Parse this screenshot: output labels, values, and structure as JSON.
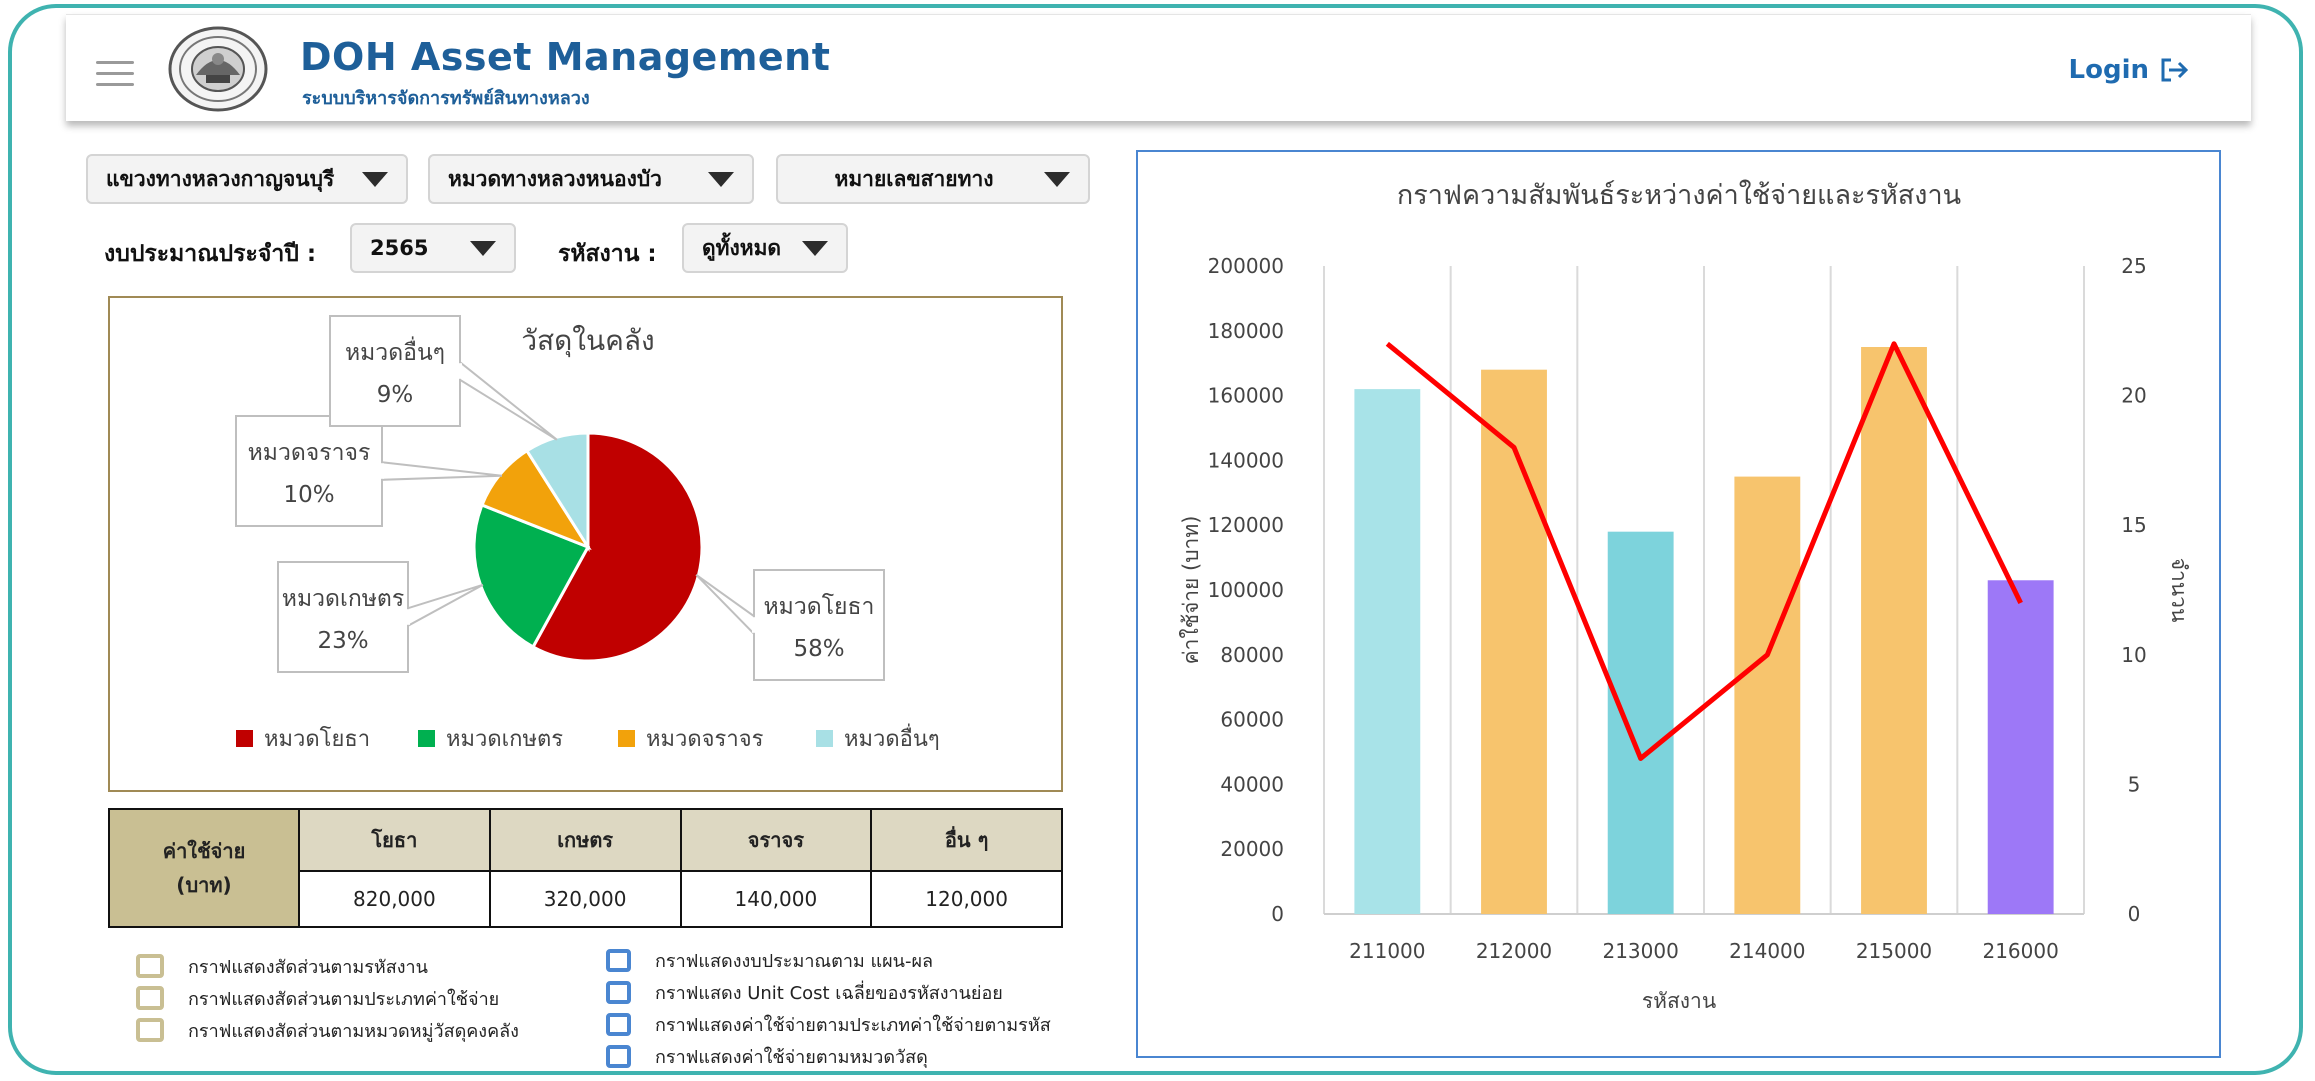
{
  "header": {
    "title": "DOH Asset Management",
    "subtitle": "ระบบบริหารจัดการทรัพย์สินทางหลวง",
    "login_label": "Login"
  },
  "filters": {
    "district_office": "แขวงทางหลวงกาญจนบุรี",
    "highway_section": "หมวดทางหลวงหนองบัว",
    "route_number": "หมายเลขสายทาง",
    "budget_year_label": "งบประมาณประจำปี :",
    "budget_year": "2565",
    "work_code_label": "รหัสงาน :",
    "work_code": "ดูทั้งหมด"
  },
  "pie": {
    "title": "วัสดุในคลัง",
    "slices": [
      {
        "name": "หมวดโยธา",
        "value": 58,
        "label": "58%",
        "color": "#c00000"
      },
      {
        "name": "หมวดเกษตร",
        "value": 23,
        "label": "23%",
        "color": "#00b050"
      },
      {
        "name": "หมวดจราจร",
        "value": 10,
        "label": "10%",
        "color": "#f2a20b"
      },
      {
        "name": "หมวดอื่นๆ",
        "value": 9,
        "label": "9%",
        "color": "#a8e0e5"
      }
    ]
  },
  "cost_table": {
    "row_label_line1": "ค่าใช้จ่าย",
    "row_label_line2": "(บาท)",
    "headers": [
      "โยธา",
      "เกษตร",
      "จราจร",
      "อื่น ๆ"
    ],
    "values": [
      "820,000",
      "320,000",
      "140,000",
      "120,000"
    ]
  },
  "links_left": [
    "กราฟแสดงสัดส่วนตามรหัสงาน",
    "กราฟแสดงสัดส่วนตามประเภทค่าใช้จ่าย",
    "กราฟแสดงสัดส่วนตามหมวดหมู่วัสดุคงคลัง"
  ],
  "links_right": [
    "กราฟแสดงงบประมาณตาม แผน-ผล",
    "กราฟแสดง Unit Cost เฉลี่ยของรหัสงานย่อย",
    "กราฟแสดงค่าใช้จ่ายตามประเภทค่าใช้จ่ายตามรหัส",
    "กราฟแสดงค่าใช้จ่ายตามหมวดวัสดุ"
  ],
  "chart_data": {
    "type": "bar",
    "title": "กราฟความสัมพันธ์ระหว่างค่าใช้จ่ายและรหัสงาน",
    "xlabel": "รหัสงาน",
    "ylabel": "ค่าใช้จ่าย (บาท)",
    "y2label": "จำนวน",
    "categories": [
      "211000",
      "212000",
      "213000",
      "214000",
      "215000",
      "216000"
    ],
    "ylim": [
      0,
      200000
    ],
    "yticks": [
      0,
      20000,
      40000,
      60000,
      80000,
      100000,
      120000,
      140000,
      160000,
      180000,
      200000
    ],
    "y2lim": [
      0,
      25
    ],
    "y2ticks": [
      0,
      5,
      10,
      15,
      20,
      25
    ],
    "bars": [
      162000,
      168000,
      118000,
      135000,
      175000,
      103000
    ],
    "bar_colors": [
      "#a8e3e8",
      "#f7c46d",
      "#7dd3dc",
      "#f7c46d",
      "#f7c46d",
      "#9d78f7"
    ],
    "line": [
      22,
      18,
      6,
      10,
      22,
      12
    ],
    "line_color": "#ff0000",
    "grid": "vertical"
  }
}
